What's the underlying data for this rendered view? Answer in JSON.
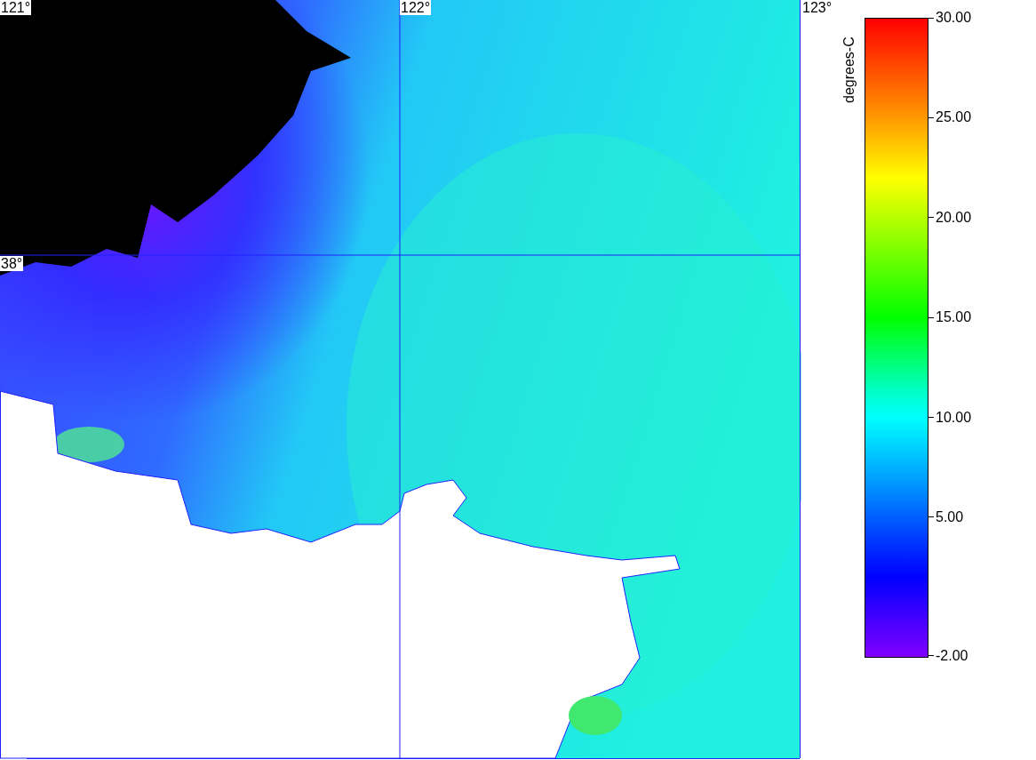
{
  "map": {
    "longitude_labels": [
      "121°",
      "122°",
      "123°"
    ],
    "latitude_labels": [
      "38°"
    ]
  },
  "colorbar": {
    "unit_label": "degrees-C",
    "ticks": [
      "30.00",
      "25.00",
      "20.00",
      "15.00",
      "10.00",
      "5.00",
      "-2.00"
    ]
  }
}
